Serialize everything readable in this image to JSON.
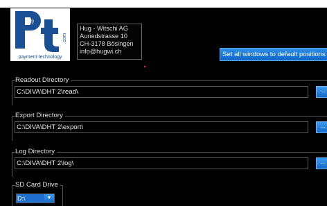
{
  "logo": {
    "tagline": "payment-technology",
    "domain": ".com"
  },
  "address": {
    "line1": "Hug - Witschi AG",
    "line2": "Auriedstrasse 10",
    "line3": "CH-3178 Bösingen",
    "line4": "info@hugwi.ch"
  },
  "reset_windows_button": "Set all windows to default positions",
  "readout": {
    "title": "Readout Directory",
    "path": "C:\\DIVA\\DHT 2\\read\\",
    "browse": "..."
  },
  "export": {
    "title": "Export Directory",
    "path": "C:\\DIVA\\DHT 2\\export\\",
    "browse": "..."
  },
  "log": {
    "title": "Log Directory",
    "path": "C:\\DIVA\\DHT 2\\log\\",
    "browse": "..."
  },
  "sd_card": {
    "title": "SD Card Drive",
    "selected": "D:\\"
  },
  "colors": {
    "accent": "#1668c8",
    "logo_blue": "#1a4f94",
    "background": "#000000"
  }
}
